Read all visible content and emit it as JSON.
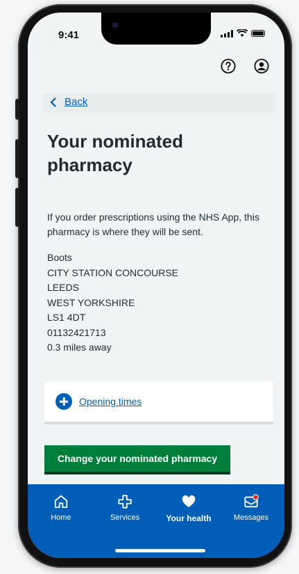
{
  "status": {
    "time": "9:41"
  },
  "back": {
    "label": "Back"
  },
  "page": {
    "title": "Your nominated pharmacy",
    "intro": "If you order prescriptions using the NHS App, this pharmacy is where they will be sent."
  },
  "pharmacy": {
    "name": "Boots",
    "address_line1": "CITY STATION CONCOURSE",
    "city": "LEEDS",
    "county": "WEST YORKSHIRE",
    "postcode": "LS1 4DT",
    "phone": "01132421713",
    "distance": "0.3 miles away"
  },
  "opening_times": {
    "label": "Opening times",
    "icon": "plus-circle-icon"
  },
  "cta": {
    "label": "Change your nominated pharmacy"
  },
  "nav": {
    "items": [
      {
        "label": "Home",
        "icon": "home-icon"
      },
      {
        "label": "Services",
        "icon": "cross-icon"
      },
      {
        "label": "Your health",
        "icon": "heart-icon"
      },
      {
        "label": "Messages",
        "icon": "envelope-icon"
      }
    ]
  },
  "colors": {
    "accent": "#005eb8",
    "cta": "#007f3b",
    "background": "#f0f4f5"
  }
}
